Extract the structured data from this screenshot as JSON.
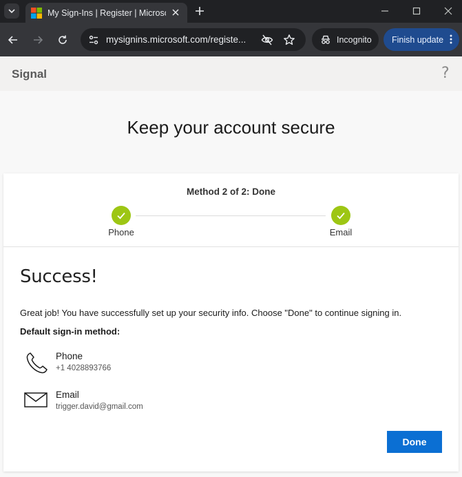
{
  "browser": {
    "tab_title": "My Sign-Ins | Register | Microsoft",
    "url": "mysignins.microsoft.com/registe...",
    "incognito_label": "Incognito",
    "finish_update_label": "Finish update"
  },
  "header": {
    "brand": "Signal",
    "help": "?"
  },
  "main": {
    "headline": "Keep your account secure",
    "step_title": "Method 2 of 2: Done",
    "steps": [
      {
        "label": "Phone"
      },
      {
        "label": "Email"
      }
    ],
    "success_title": "Success!",
    "description": "Great job! You have successfully set up your security info. Choose \"Done\" to continue signing in.",
    "default_label": "Default sign-in method:",
    "methods": [
      {
        "name": "Phone",
        "value": "+1 4028893766",
        "icon": "phone-icon"
      },
      {
        "name": "Email",
        "value": "trigger.david@gmail.com",
        "icon": "mail-icon"
      }
    ],
    "done_label": "Done"
  },
  "colors": {
    "accent": "#0b6fd3",
    "check_green": "#9dc614",
    "finish_update_bg": "#1f4b8f"
  }
}
